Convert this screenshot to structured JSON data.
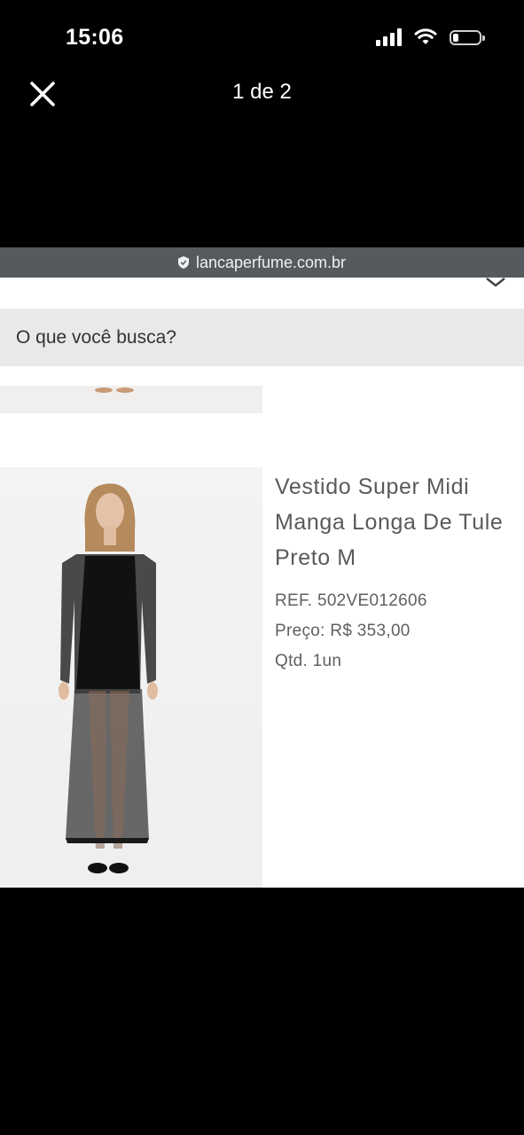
{
  "status_bar": {
    "time": "15:06"
  },
  "viewer": {
    "page_counter": "1 de 2"
  },
  "browser": {
    "url": "lancaperfume.com.br"
  },
  "search": {
    "placeholder": "O que você busca?"
  },
  "product": {
    "title": "Vestido Super Midi Manga Longa De Tule Preto M",
    "ref": "REF. 502VE012606",
    "price": "Preço: R$ 353,00",
    "qty": "Qtd. 1un"
  },
  "icons": {
    "close": "close-icon",
    "signal": "signal-icon",
    "wifi": "wifi-icon",
    "battery": "battery-icon",
    "shield": "shield-icon"
  }
}
